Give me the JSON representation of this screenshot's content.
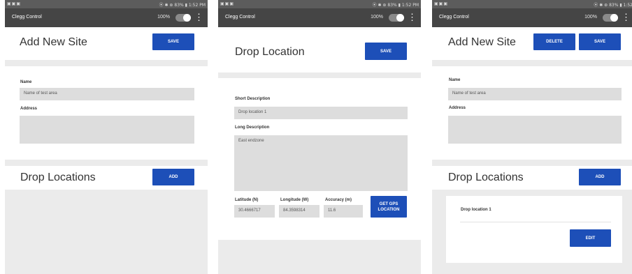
{
  "app": {
    "title": "Clegg Control",
    "battery": "100%",
    "battery_alt": "100%",
    "menu_icon": "kebab-menu-icon",
    "status_left": "▣▣▣",
    "status_right_1": "⦿ ✱ ⊛ 83% ▮ 1:52 PM",
    "status_right_2": "⦿ ✱ ⊛ 83% ▮ 1:52 PM",
    "status_right_3": "⦿ ✱ ⊛ 83% ▮ 1:52"
  },
  "screen1": {
    "heading": "Add New Site",
    "save_label": "SAVE",
    "name_label": "Name",
    "name_value": "Name of test area",
    "address_label": "Address",
    "address_value": "",
    "drop_heading": "Drop Locations",
    "add_label": "ADD"
  },
  "screen2": {
    "heading": "Drop Location",
    "save_label": "SAVE",
    "short_label": "Short Description",
    "short_value": "Drop location 1",
    "long_label": "Long Description",
    "long_value": "East endzone",
    "lat_label": "Latitude (N)",
    "lat_value": "30.4666717",
    "lon_label": "Longitude (W)",
    "lon_value": "84.3598314",
    "acc_label": "Accuracy (m)",
    "acc_value": "11.6",
    "gps_label": "GET GPS LOCATION"
  },
  "screen3": {
    "heading": "Add New Site",
    "delete_label": "DELETE",
    "save_label": "SAVE",
    "name_label": "Name",
    "name_value": "Name of test area",
    "address_label": "Address",
    "address_value": "",
    "drop_heading": "Drop Locations",
    "add_label": "ADD",
    "drop_item": "Drop location 1",
    "edit_label": "EDIT"
  },
  "colors": {
    "appbar": "#454545",
    "statusbar": "#5c5c5c",
    "accent": "#1d4fb8",
    "field": "#dddddd",
    "section_bg": "#ebebeb"
  }
}
